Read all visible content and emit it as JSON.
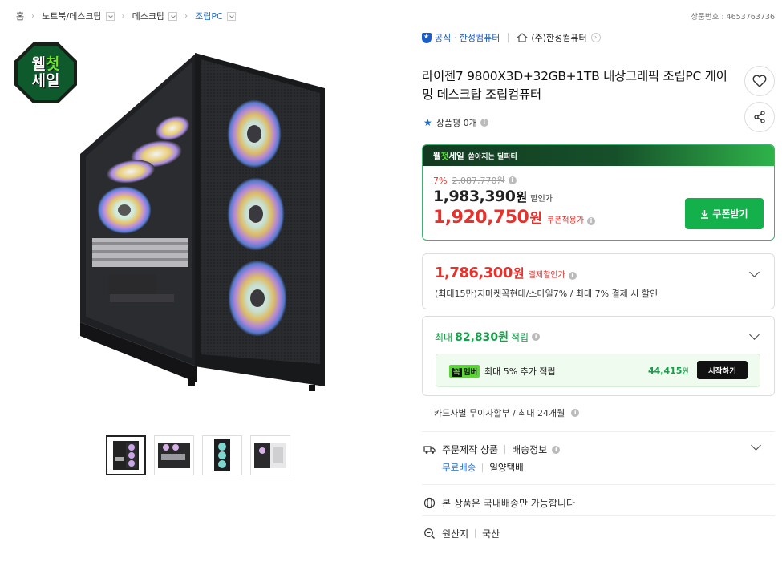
{
  "breadcrumb": {
    "home": "홈",
    "items": [
      "노트북/데스크탑",
      "데스크탑",
      "조립PC"
    ]
  },
  "product_no": "상품번호 : 4653763736",
  "badge": {
    "line1_a": "웰",
    "line1_b": "첫",
    "line2": "세일"
  },
  "store": {
    "official": "공식 · 한성컴퓨터",
    "name": "(주)한성컴퓨터"
  },
  "title": "라이젠7 9800X3D+32GB+1TB 내장그래픽 조립PC 게이밍 데스크탑 조립컴퓨터",
  "review": {
    "label": "상품평 0개"
  },
  "deal": {
    "head_a": "웰",
    "head_b": "첫",
    "head_c": "세일",
    "head_sub": "쏟아지는 딜파티",
    "discount_pct": "7%",
    "original_price": "2,087,770원",
    "sale_price": "1,983,390",
    "sale_unit": "원",
    "sale_label": "할인가",
    "coupon_price": "1,920,750",
    "coupon_unit": "원",
    "coupon_label": "쿠폰적용가",
    "coupon_button": "쿠폰받기"
  },
  "payment": {
    "price": "1,786,300",
    "unit": "원",
    "label": "결제할인가",
    "sub": "(최대15만)지마켓꼭현대/스마일7% / 최대 7% 결제 시 할인"
  },
  "points": {
    "prefix": "최대",
    "amount": "82,830원",
    "suffix": "적립",
    "member_tag_a": "꼭",
    "member_tag_b": "멤버",
    "member_text": "최대 5% 추가 적립",
    "member_amount": "44,415",
    "member_unit": "원",
    "start_button": "시작하기"
  },
  "card_installment": "카드사별 무이자할부 / 최대 24개월",
  "shipping": {
    "custom": "주문제작 상품",
    "info": "배송정보",
    "free": "무료배송",
    "method": "일양택배"
  },
  "domestic": "본 상품은 국내배송만 가능합니다",
  "origin": {
    "label": "원산지",
    "value": "국산"
  },
  "colors": {
    "accent_green": "#13b04b",
    "price_red": "#e5322d",
    "link_blue": "#1a6bd4"
  }
}
